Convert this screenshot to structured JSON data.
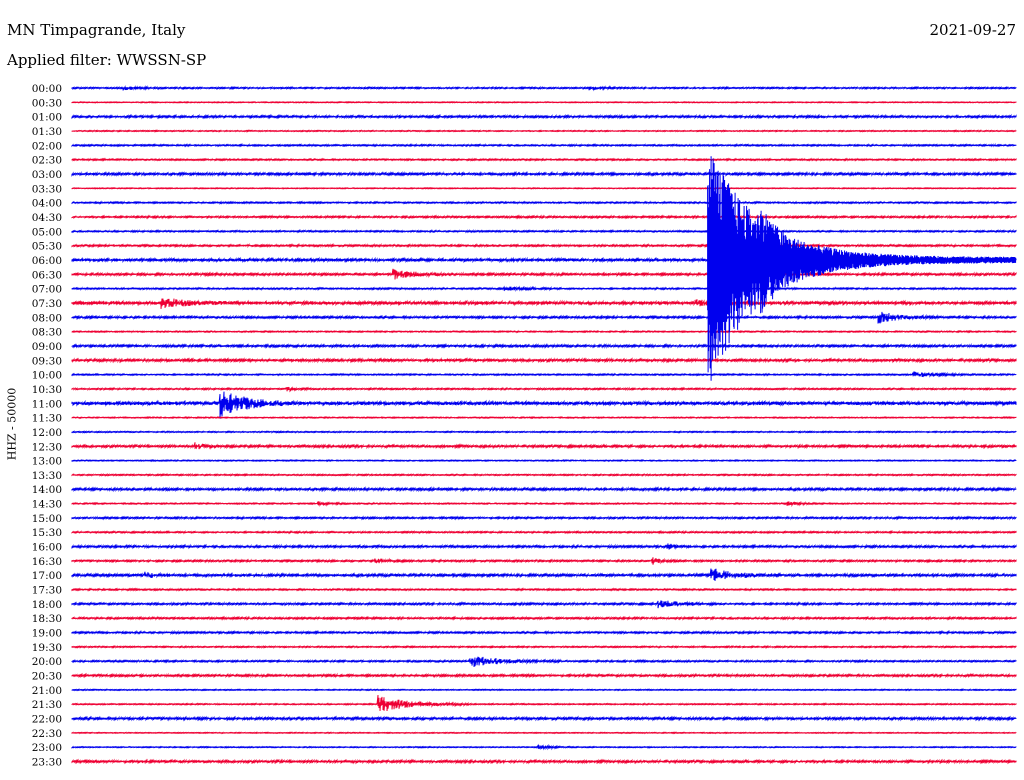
{
  "header": {
    "station": "MN Timpagrande, Italy",
    "filter": "Applied filter: WWSSN-SP",
    "date": "2021-09-27"
  },
  "chart_data": {
    "type": "helicorder",
    "title": "MN Timpagrande, Italy",
    "subtitle": "Applied filter: WWSSN-SP",
    "date": "2021-09-27",
    "ylabel": "HHZ - 50000",
    "colors": {
      "odd": "#0000ee",
      "even": "#ee0033"
    },
    "rows": [
      "00:00",
      "00:30",
      "01:00",
      "01:30",
      "02:00",
      "02:30",
      "03:00",
      "03:30",
      "04:00",
      "04:30",
      "05:00",
      "05:30",
      "06:00",
      "06:30",
      "07:00",
      "07:30",
      "08:00",
      "08:30",
      "09:00",
      "09:30",
      "10:00",
      "10:30",
      "11:00",
      "11:30",
      "12:00",
      "12:30",
      "13:00",
      "13:30",
      "14:00",
      "14:30",
      "15:00",
      "15:30",
      "16:00",
      "16:30",
      "17:00",
      "17:30",
      "18:00",
      "18:30",
      "19:00",
      "19:30",
      "20:00",
      "20:30",
      "21:00",
      "21:30",
      "22:00",
      "22:30",
      "23:00",
      "23:30"
    ],
    "row_minutes": 30,
    "noise": [
      1,
      0.6,
      1.4,
      0.7,
      1,
      1,
      1.6,
      0.6,
      1,
      1.2,
      1,
      1.2,
      2,
      1.5,
      1,
      2.2,
      1.4,
      0.8,
      1.5,
      1.8,
      0.9,
      1,
      2.5,
      0.7,
      0.8,
      1.6,
      0.7,
      0.9,
      1.6,
      0.8,
      1.2,
      1,
      1.4,
      1.2,
      1.7,
      1,
      1.3,
      1.2,
      1.2,
      0.9,
      1.1,
      1.4,
      0.7,
      0.8,
      1.7,
      0.6,
      0.7,
      1.6
    ],
    "events": [
      {
        "row": "11:00",
        "minute": 4.7,
        "amp": 14,
        "duration": 2.5
      },
      {
        "row": "06:30",
        "minute": 10.2,
        "amp": 5,
        "duration": 2.0
      },
      {
        "row": "07:30",
        "minute": 2.8,
        "amp": 5,
        "duration": 2.5
      },
      {
        "row": "21:30",
        "minute": 9.7,
        "amp": 9,
        "duration": 3.0
      },
      {
        "row": "20:00",
        "minute": 12.6,
        "amp": 6,
        "duration": 3.0
      },
      {
        "row": "17:00",
        "minute": 20.3,
        "amp": 7,
        "duration": 2.2
      },
      {
        "row": "18:00",
        "minute": 18.6,
        "amp": 4,
        "duration": 2.0
      },
      {
        "row": "08:00",
        "minute": 25.6,
        "amp": 6,
        "duration": 2.0
      },
      {
        "row": "10:00",
        "minute": 26.7,
        "amp": 3,
        "duration": 2.0
      },
      {
        "row": "12:30",
        "minute": 3.9,
        "amp": 3,
        "duration": 1.0
      },
      {
        "row": "07:00",
        "minute": 13.7,
        "amp": 2,
        "duration": 2.0
      },
      {
        "row": "16:00",
        "minute": 18.9,
        "amp": 3,
        "duration": 0.8
      },
      {
        "row": "16:30",
        "minute": 9.6,
        "amp": 3,
        "duration": 1.0
      },
      {
        "row": "16:30",
        "minute": 18.4,
        "amp": 4,
        "duration": 0.8
      },
      {
        "row": "14:30",
        "minute": 7.8,
        "amp": 2,
        "duration": 1.0
      },
      {
        "row": "14:30",
        "minute": 22.7,
        "amp": 2,
        "duration": 1.2
      },
      {
        "row": "00:00",
        "minute": 1.6,
        "amp": 2,
        "duration": 1.5
      },
      {
        "row": "00:00",
        "minute": 16.4,
        "amp": 2,
        "duration": 1.2
      },
      {
        "row": "17:00",
        "minute": 2.3,
        "amp": 3,
        "duration": 1.0
      },
      {
        "row": "23:00",
        "minute": 14.8,
        "amp": 2,
        "duration": 1.5
      },
      {
        "row": "10:30",
        "minute": 6.8,
        "amp": 2,
        "duration": 0.8
      },
      {
        "row": "07:30",
        "minute": 19.8,
        "amp": 3,
        "duration": 1.5
      }
    ],
    "quake": {
      "row": "06:00",
      "minute": 20.2,
      "amp_up": 115,
      "amp_down": 128,
      "aftershock": {
        "minute": 21.8,
        "amp": 62
      },
      "coda_until_minute": 31
    }
  }
}
